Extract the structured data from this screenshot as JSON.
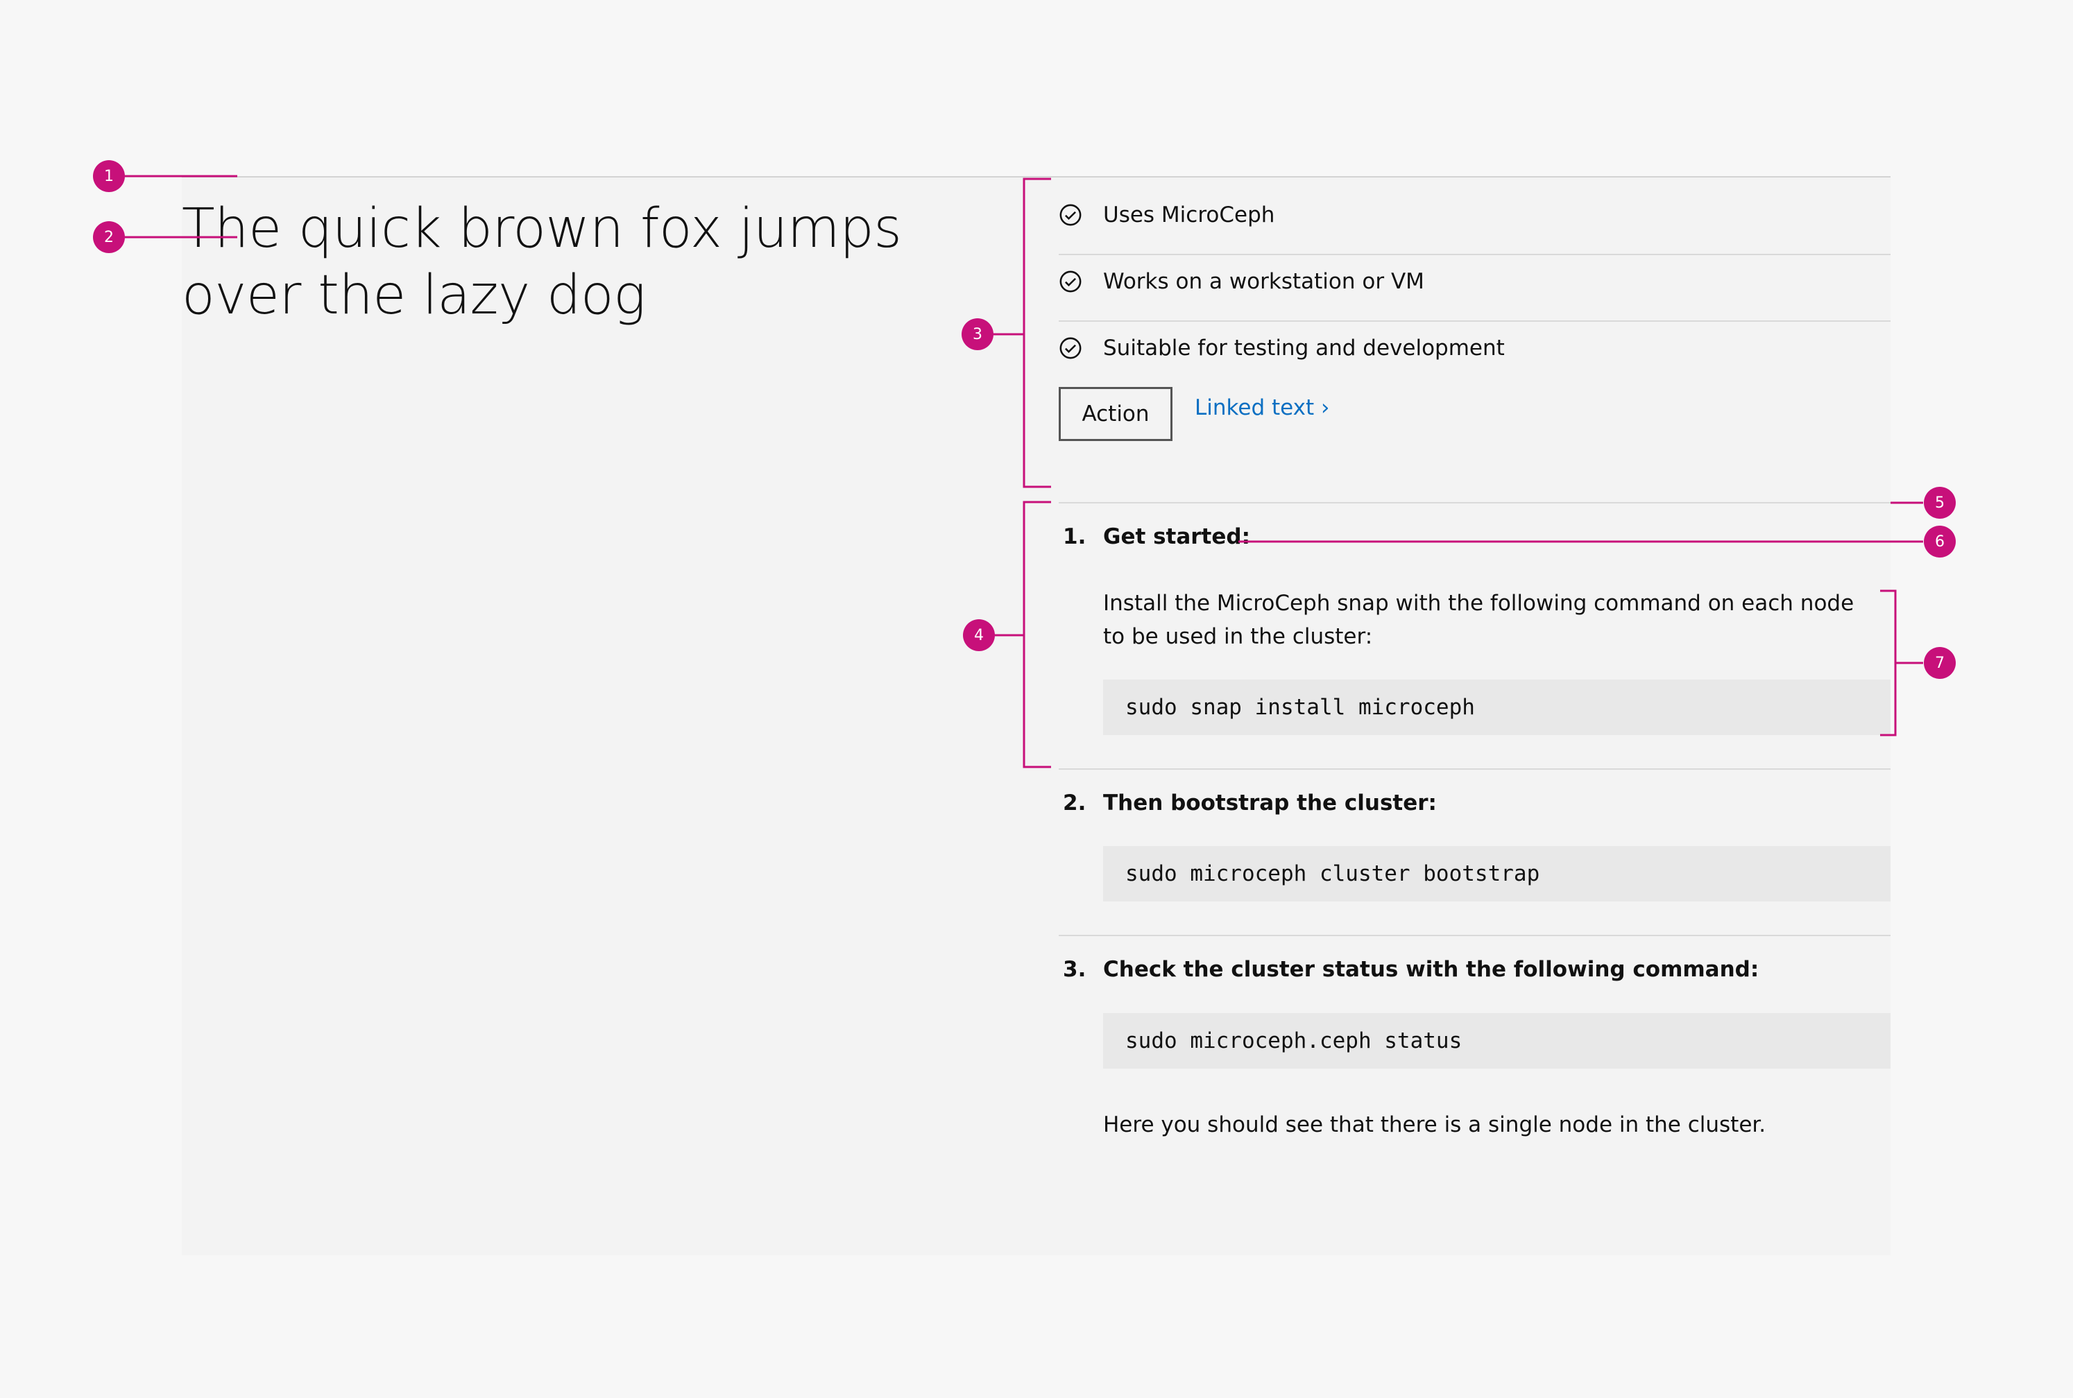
{
  "hero": {
    "title": "The quick brown fox jumps over the lazy dog"
  },
  "features": {
    "items": [
      {
        "label": "Uses MicroCeph",
        "icon": "check-circle-icon"
      },
      {
        "label": "Works on a workstation or VM",
        "icon": "check-circle-icon"
      },
      {
        "label": "Suitable for testing and development",
        "icon": "check-circle-icon"
      }
    ],
    "action_label": "Action",
    "link_label": "Linked text ›"
  },
  "steps": [
    {
      "number": "1.",
      "title": "Get started:",
      "text": "Install the MicroCeph snap with the following command on each node to be used in the cluster:",
      "code": "sudo snap install microceph"
    },
    {
      "number": "2.",
      "title": "Then bootstrap the cluster:",
      "code": "sudo microceph cluster bootstrap"
    },
    {
      "number": "3.",
      "title": "Check the cluster status with the following command:",
      "code": "sudo microceph.ceph status",
      "note": "Here you should see that there is a single node in the cluster."
    }
  ],
  "annotations": {
    "color": "#c7107a",
    "markers": [
      "1",
      "2",
      "3",
      "4",
      "5",
      "6",
      "7"
    ]
  }
}
